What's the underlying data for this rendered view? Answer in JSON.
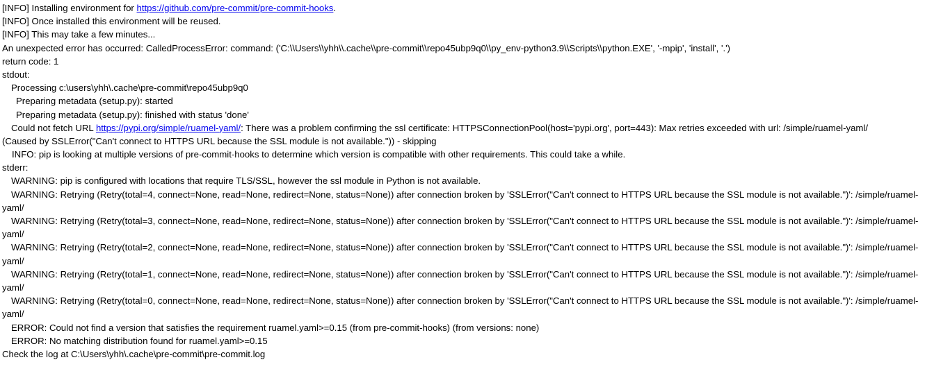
{
  "log": {
    "l1_prefix": "[INFO] Installing environment for ",
    "l1_link": "https://github.com/pre-commit/pre-commit-hooks",
    "l1_suffix": ".",
    "l2": "[INFO] Once installed this environment will be reused.",
    "l3": "[INFO] This may take a few minutes...",
    "l4": "An unexpected error has occurred: CalledProcessError: command: ('C:\\\\Users\\\\yhh\\\\.cache\\\\pre-commit\\\\repo45ubp9q0\\\\py_env-python3.9\\\\Scripts\\\\python.EXE', '-mpip', 'install', '.')",
    "l5": "return code: 1",
    "l6": "stdout:",
    "l7": "Processing c:\\users\\yhh\\.cache\\pre-commit\\repo45ubp9q0",
    "l8": "Preparing metadata (setup.py): started",
    "l9": "Preparing metadata (setup.py): finished with status 'done'",
    "l10_prefix": "Could not fetch URL ",
    "l10_link": "https://pypi.org/simple/ruamel-yaml/",
    "l10_suffix": ": There was a problem confirming the ssl certificate: HTTPSConnectionPool(host='pypi.org', port=443): Max retries exceeded with url: /simple/ruamel-yaml/",
    "l11": "(Caused by SSLError(\"Can't connect to HTTPS URL because the SSL module is not available.\")) - skipping",
    "l12": "INFO: pip is looking at multiple versions of pre-commit-hooks to determine which version is compatible with other requirements. This could take a while.",
    "l13": "stderr:",
    "l14": "WARNING: pip is configured with locations that require TLS/SSL, however the ssl module in Python is not available.",
    "w4_a": "WARNING: Retrying (Retry(total=4, connect=None, read=None, redirect=None, status=None)) after connection broken by 'SSLError(\"Can't connect to HTTPS URL because the SSL module is not available.\")': /simple/ruamel-",
    "w4_b": "yaml/",
    "w3_a": "WARNING: Retrying (Retry(total=3, connect=None, read=None, redirect=None, status=None)) after connection broken by 'SSLError(\"Can't connect to HTTPS URL because the SSL module is not available.\")': /simple/ruamel-",
    "w3_b": "yaml/",
    "w2_a": "WARNING: Retrying (Retry(total=2, connect=None, read=None, redirect=None, status=None)) after connection broken by 'SSLError(\"Can't connect to HTTPS URL because the SSL module is not available.\")': /simple/ruamel-",
    "w2_b": "yaml/",
    "w1_a": "WARNING: Retrying (Retry(total=1, connect=None, read=None, redirect=None, status=None)) after connection broken by 'SSLError(\"Can't connect to HTTPS URL because the SSL module is not available.\")': /simple/ruamel-",
    "w1_b": "yaml/",
    "w0_a": "WARNING: Retrying (Retry(total=0, connect=None, read=None, redirect=None, status=None)) after connection broken by 'SSLError(\"Can't connect to HTTPS URL because the SSL module is not available.\")': /simple/ruamel-",
    "w0_b": "yaml/",
    "e1": "ERROR: Could not find a version that satisfies the requirement ruamel.yaml>=0.15 (from pre-commit-hooks) (from versions: none)",
    "e2": "ERROR: No matching distribution found for ruamel.yaml>=0.15",
    "last": "Check the log at C:\\Users\\yhh\\.cache\\pre-commit\\pre-commit.log"
  },
  "colors": {
    "text": "#000000",
    "link": "#0000ee",
    "background": "#ffffff"
  }
}
